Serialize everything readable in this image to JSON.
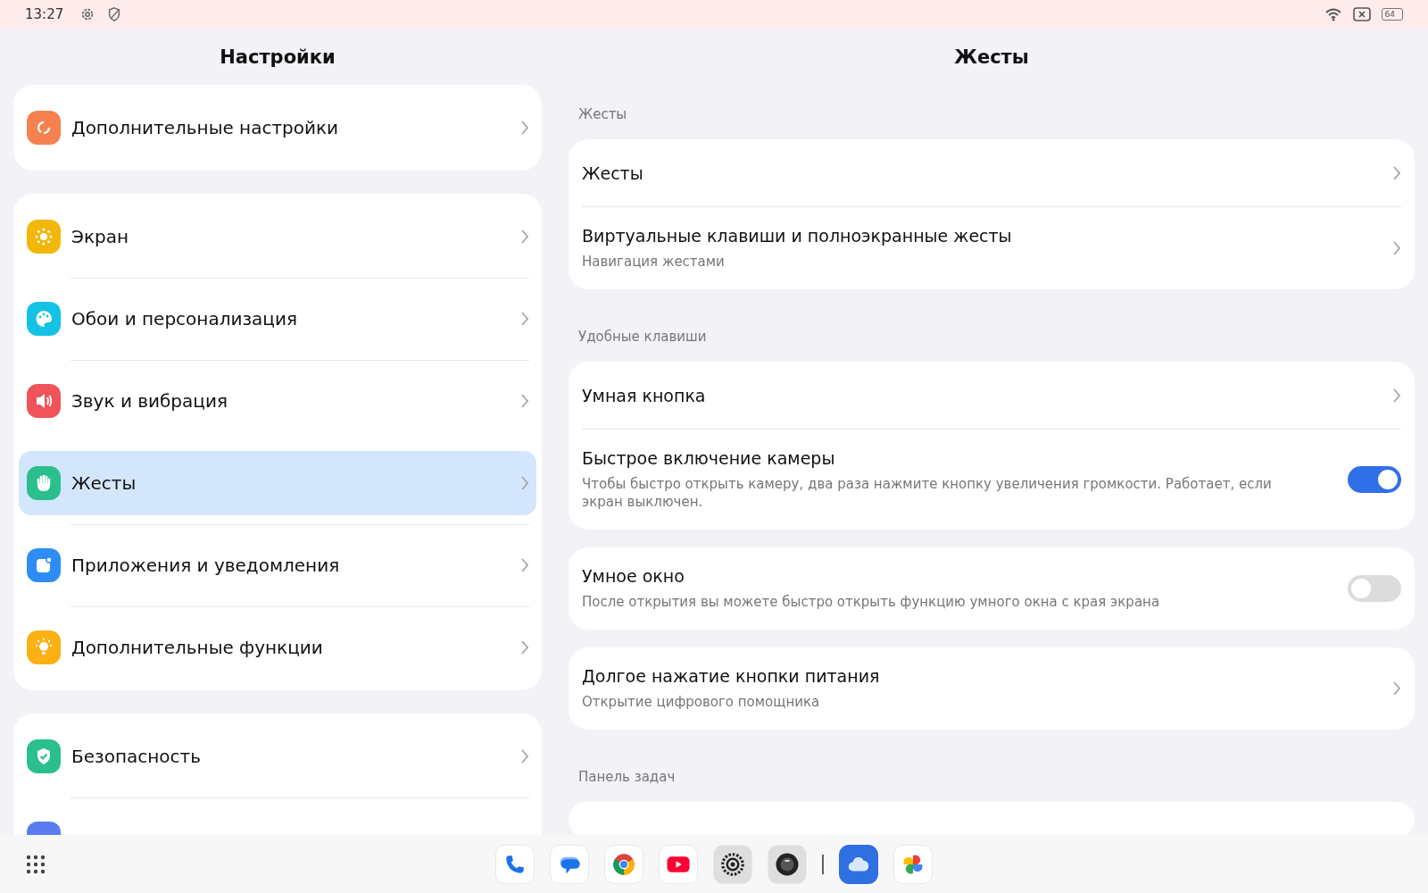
{
  "status_bar": {
    "time": "13:27",
    "battery": "64"
  },
  "left": {
    "title": "Настройки",
    "groups": [
      {
        "items": [
          {
            "label": "Дополнительные настройки",
            "color": "#f5814f",
            "selected": false
          }
        ]
      },
      {
        "items": [
          {
            "label": "Экран",
            "color": "#f3b70a",
            "selected": false
          },
          {
            "label": "Обои и персонализация",
            "color": "#14c2e6",
            "selected": false
          },
          {
            "label": "Звук и вибрация",
            "color": "#f0535a",
            "selected": false
          },
          {
            "label": "Жесты",
            "color": "#2bbf8e",
            "selected": true
          },
          {
            "label": "Приложения и уведомления",
            "color": "#2d8cf5",
            "selected": false
          },
          {
            "label": "Дополнительные функции",
            "color": "#fbb014",
            "selected": false
          }
        ]
      },
      {
        "items": [
          {
            "label": "Безопасность",
            "color": "#2bbf8e",
            "selected": false
          },
          {
            "color": "#5b7cf0",
            "selected": false
          }
        ]
      }
    ]
  },
  "right": {
    "title": "Жесты",
    "sections": [
      {
        "heading": "Жесты",
        "cards": [
          {
            "rows": [
              {
                "kind": "link",
                "title": "Жесты"
              },
              {
                "kind": "link",
                "title": "Виртуальные клавиши и полноэкранные жесты",
                "subtitle": "Навигация жестами"
              }
            ]
          }
        ]
      },
      {
        "heading": "Удобные клавиши",
        "cards": [
          {
            "rows": [
              {
                "kind": "link",
                "title": "Умная кнопка"
              },
              {
                "kind": "toggle",
                "title": "Быстрое включение камеры",
                "subtitle": "Чтобы быстро открыть камеру, два раза нажмите кнопку увеличения громкости. Работает, если экран выключен.",
                "on": true
              }
            ]
          },
          {
            "rows": [
              {
                "kind": "toggle",
                "title": "Умное окно",
                "subtitle": "После открытия вы можете быстро открыть функцию умного окна с края экрана",
                "on": false
              }
            ]
          },
          {
            "rows": [
              {
                "kind": "link",
                "title": "Долгое нажатие кнопки питания",
                "subtitle": "Открытие цифрового помощника"
              }
            ]
          }
        ]
      },
      {
        "heading": "Панель задач"
      }
    ]
  }
}
